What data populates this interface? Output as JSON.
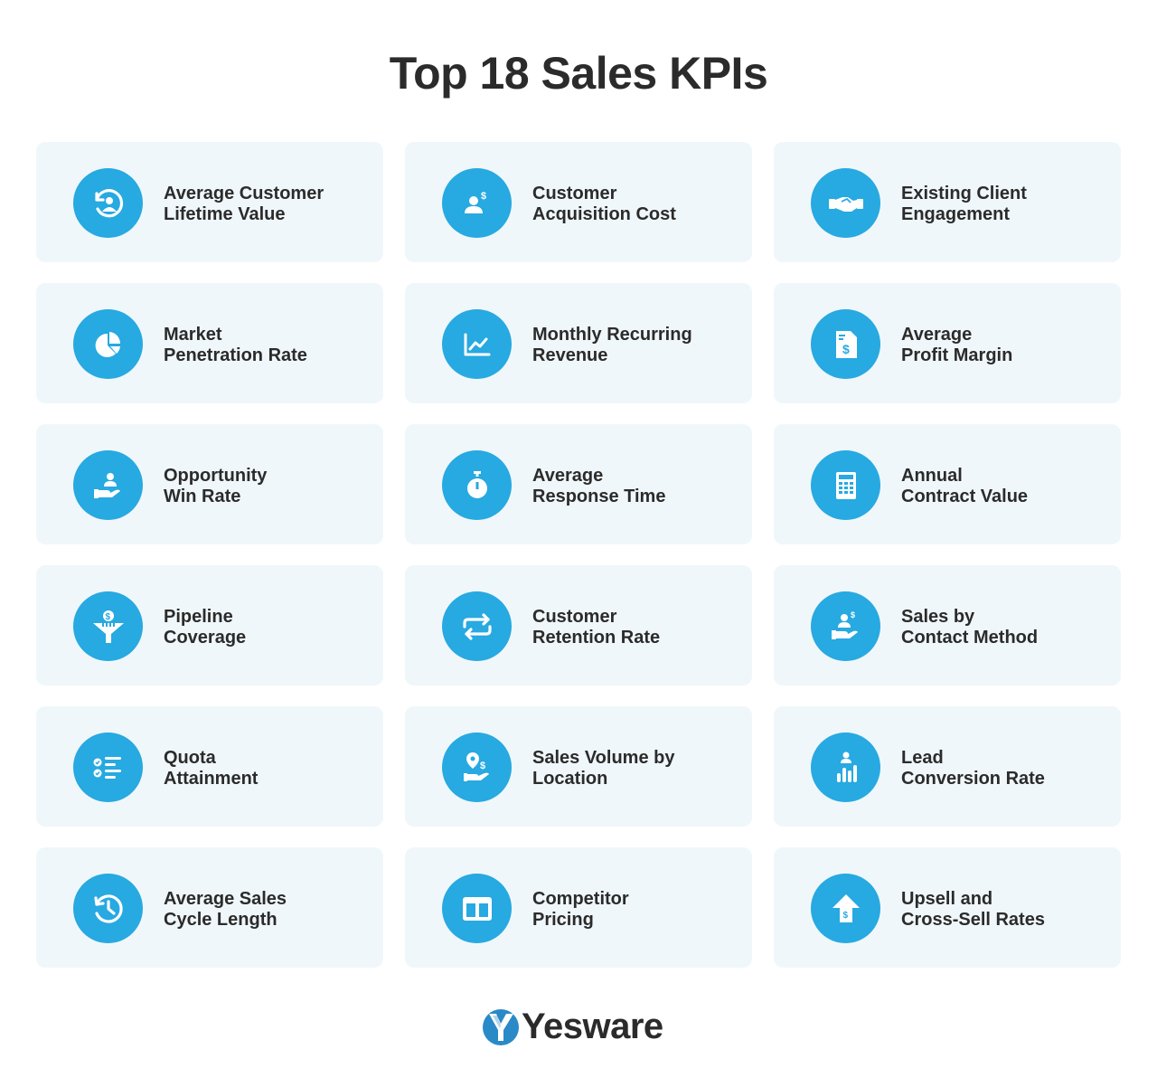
{
  "title": "Top 18 Sales KPIs",
  "accent_color": "#27a9e1",
  "card_color": "#f0f7fa",
  "kpis": [
    {
      "line1": "Average Customer",
      "line2": "Lifetime Value",
      "icon": "customer-lifetime-icon"
    },
    {
      "line1": "Customer",
      "line2": "Acquisition Cost",
      "icon": "acquisition-cost-icon"
    },
    {
      "line1": "Existing Client",
      "line2": "Engagement",
      "icon": "handshake-icon"
    },
    {
      "line1": "Market",
      "line2": "Penetration Rate",
      "icon": "pie-chart-icon"
    },
    {
      "line1": "Monthly Recurring",
      "line2": "Revenue",
      "icon": "line-chart-icon"
    },
    {
      "line1": "Average",
      "line2": "Profit Margin",
      "icon": "invoice-icon"
    },
    {
      "line1": "Opportunity",
      "line2": "Win Rate",
      "icon": "hand-person-icon"
    },
    {
      "line1": "Average",
      "line2": "Response Time",
      "icon": "stopwatch-icon"
    },
    {
      "line1": "Annual",
      "line2": "Contract Value",
      "icon": "calculator-icon"
    },
    {
      "line1": "Pipeline",
      "line2": "Coverage",
      "icon": "funnel-dollar-icon"
    },
    {
      "line1": "Customer",
      "line2": "Retention Rate",
      "icon": "repeat-icon"
    },
    {
      "line1": "Sales by",
      "line2": "Contact Method",
      "icon": "hand-person-dollar-icon"
    },
    {
      "line1": "Quota",
      "line2": "Attainment",
      "icon": "checklist-icon"
    },
    {
      "line1": "Sales Volume by",
      "line2": "Location",
      "icon": "location-hand-icon"
    },
    {
      "line1": "Lead",
      "line2": "Conversion Rate",
      "icon": "person-bar-chart-icon"
    },
    {
      "line1": "Average Sales",
      "line2": "Cycle Length",
      "icon": "history-clock-icon"
    },
    {
      "line1": "Competitor",
      "line2": "Pricing",
      "icon": "columns-icon"
    },
    {
      "line1": "Upsell and",
      "line2": "Cross-Sell Rates",
      "icon": "arrow-up-dollar-icon"
    }
  ],
  "logo": {
    "text": "Yesware"
  }
}
